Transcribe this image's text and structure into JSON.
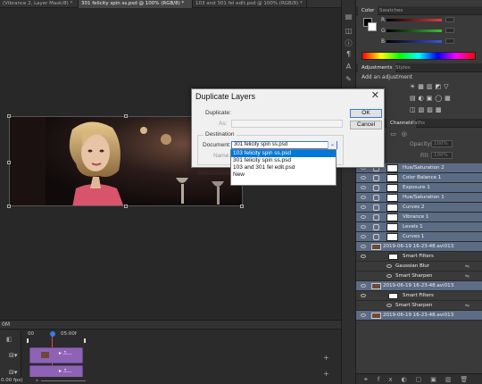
{
  "tabs": [
    {
      "label": "(Vibrance 2, Layer Mask/8) *",
      "active": false
    },
    {
      "label": "301 felicity spin ss.psd @ 100% (RGB/8) *",
      "active": true
    },
    {
      "label": "103 and 301 fel edit.psd @ 100% (RGB/8) *",
      "active": false
    }
  ],
  "color_panel": {
    "tabs": [
      "Color",
      "Swatches"
    ],
    "sliders": [
      {
        "label": "R",
        "value": "",
        "color": "#e23b3b"
      },
      {
        "label": "G",
        "value": "",
        "color": "#3bbf3b"
      },
      {
        "label": "B",
        "value": "",
        "color": "#3b55e2"
      }
    ]
  },
  "adjustments_panel": {
    "tabs": [
      "Adjustments",
      "Styles"
    ],
    "heading": "Add an adjustment"
  },
  "layers_panel": {
    "tabs": [
      "Channels",
      "Paths"
    ],
    "opacity_label": "Opacity:",
    "opacity_value": "100%",
    "fill_label": "Fill:",
    "fill_value": "100%",
    "layers": [
      {
        "name": "Hue/Saturation 2",
        "kind": "adj"
      },
      {
        "name": "Color Balance 1",
        "kind": "adj"
      },
      {
        "name": "Exposure 1",
        "kind": "adj"
      },
      {
        "name": "Hue/Saturation 1",
        "kind": "adj"
      },
      {
        "name": "Curves 2",
        "kind": "adj"
      },
      {
        "name": "Vibrance 1",
        "kind": "adj"
      },
      {
        "name": "Levels 1",
        "kind": "adj"
      },
      {
        "name": "Curves 1",
        "kind": "adj"
      },
      {
        "name": "2019-06-19 16-23-48.avi0132 co...",
        "kind": "smart"
      },
      {
        "name": "Smart Filters",
        "kind": "filterhead"
      },
      {
        "name": "Gaussian Blur",
        "kind": "filter"
      },
      {
        "name": "Smart Sharpen",
        "kind": "filter"
      },
      {
        "name": "2019-06-19 16-23-48.avi0132 copy",
        "kind": "smart"
      },
      {
        "name": "Smart Filters",
        "kind": "filterhead"
      },
      {
        "name": "Smart Sharpen",
        "kind": "filter"
      },
      {
        "name": "2019-06-19 16-23-48.avi0132",
        "kind": "smart"
      }
    ]
  },
  "timeline": {
    "zoom_label": "0M",
    "start_frame": "00",
    "time_marker": "05:00f",
    "fps_label": "0.00 fps)"
  },
  "dialog": {
    "title": "Duplicate Layers",
    "duplicate_label": "Duplicate:",
    "as_label": "As:",
    "destination_label": "Destination",
    "document_label": "Document:",
    "document_value": "301 felicity spin ss.psd",
    "name_label": "Name:",
    "ok_label": "OK",
    "cancel_label": "Cancel",
    "dropdown_options": [
      {
        "label": "103 felicity spin ss.psd",
        "selected": true
      },
      {
        "label": "301 felicity spin ss.psd",
        "selected": false
      },
      {
        "label": "103 and 301 fel edit.psd",
        "selected": false
      },
      {
        "label": "New",
        "selected": false
      }
    ]
  }
}
